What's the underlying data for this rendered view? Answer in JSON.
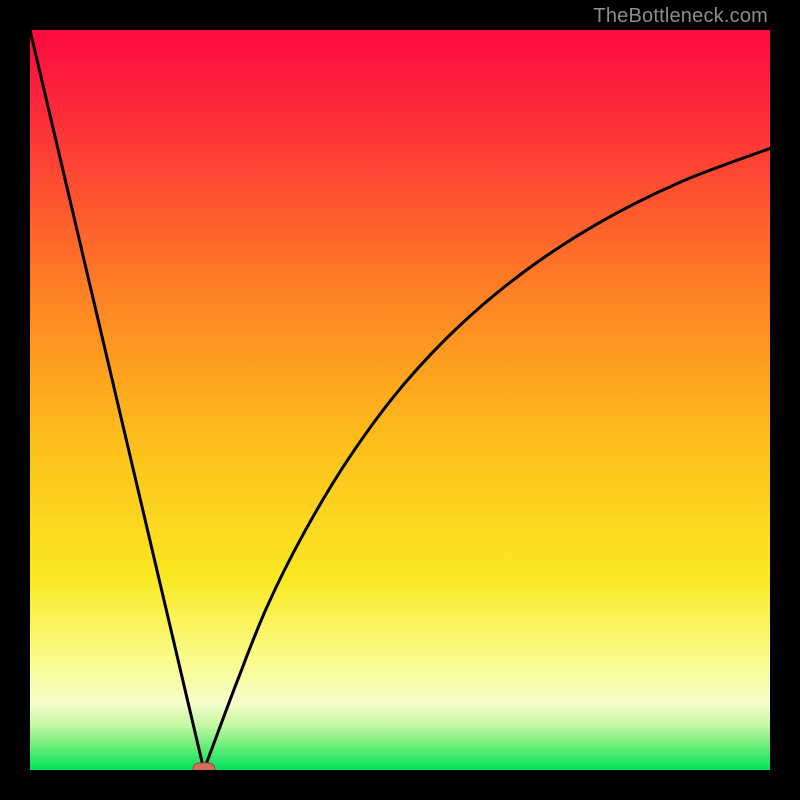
{
  "watermark": "TheBottleneck.com",
  "colors": {
    "gradient_top": "#fd093f",
    "gradient_mid1": "#fe9c1e",
    "gradient_mid2": "#fdd11a",
    "gradient_mid3": "#fafe9e",
    "gradient_bottom": "#00e45c",
    "curve": "#000000",
    "marker_fill": "#d66b60",
    "marker_stroke": "#9a4a42",
    "background": "#000000"
  },
  "chart_data": {
    "type": "line",
    "title": "",
    "xlabel": "",
    "ylabel": "",
    "xlim": [
      0,
      100
    ],
    "ylim": [
      0,
      100
    ],
    "series": [
      {
        "name": "bottleneck-curve",
        "x": [
          0,
          5,
          10,
          15,
          20,
          23.5,
          25,
          28,
          32,
          37,
          43,
          50,
          58,
          67,
          77,
          88,
          100
        ],
        "y": [
          100,
          78.7,
          57.4,
          36.2,
          14.9,
          0,
          4,
          12,
          22,
          32,
          42,
          51.5,
          60,
          67.5,
          74,
          79.5,
          84
        ]
      }
    ],
    "marker": {
      "x": 23.5,
      "y": 0,
      "shape": "rounded-rect"
    },
    "notes": "V-shaped bottleneck curve over rainbow gradient. Left branch is a steep straight descent from top-left to the minimum at x≈23.5; right branch rises concave, asymptotically flattening toward upper-right. Values estimated from pixel positions relative to the 740×740 plot area."
  }
}
